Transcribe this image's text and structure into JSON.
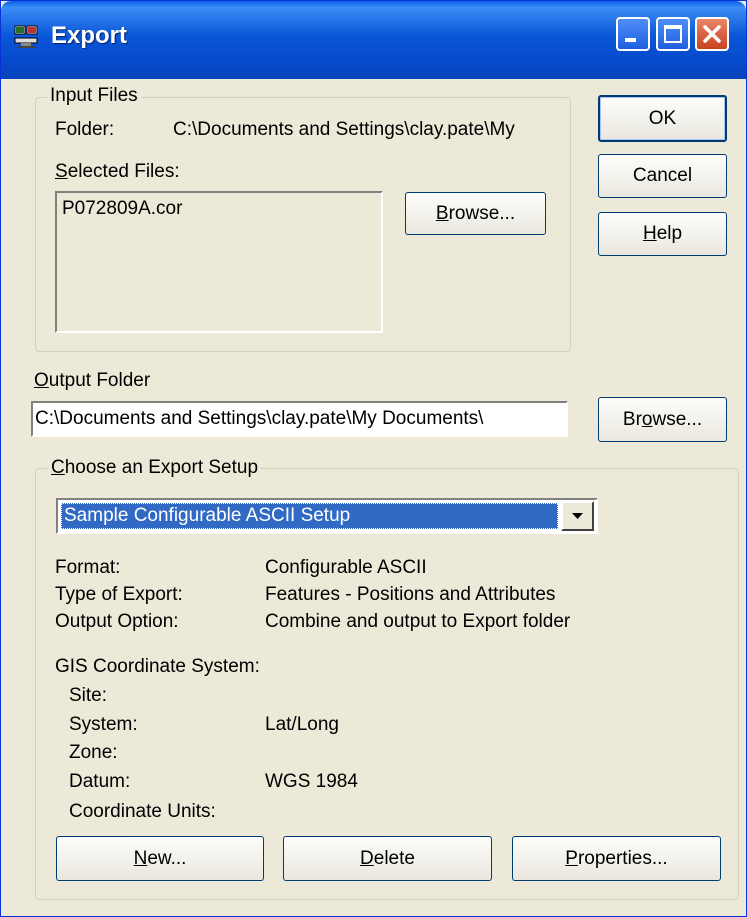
{
  "window": {
    "title": "Export"
  },
  "input_files": {
    "legend": "Input Files",
    "folder_label": "Folder:",
    "folder_value": "C:\\Documents and Settings\\clay.pate\\My",
    "selected_label_u": "S",
    "selected_label_rest": "elected Files:",
    "files": [
      "P072809A.cor"
    ],
    "browse_u": "B",
    "browse_rest": "rowse..."
  },
  "buttons": {
    "ok": "OK",
    "cancel": "Cancel",
    "help_u": "H",
    "help_rest": "elp"
  },
  "output": {
    "label_u": "O",
    "label_rest": "utput Folder",
    "value": "C:\\Documents and Settings\\clay.pate\\My Documents\\",
    "browse_pre": "Br",
    "browse_u": "o",
    "browse_rest": "wse..."
  },
  "setup": {
    "legend_u": "C",
    "legend_rest": "hoose an Export Setup",
    "selected": "Sample Configurable ASCII Setup",
    "rows": [
      {
        "label": "Format:",
        "value": "Configurable ASCII"
      },
      {
        "label": "Type of Export:",
        "value": "Features - Positions and Attributes"
      },
      {
        "label": "Output Option:",
        "value": "Combine and output to Export folder"
      }
    ],
    "gis_label": "GIS Coordinate System:",
    "gis_rows": [
      {
        "label": "Site:",
        "value": ""
      },
      {
        "label": "System:",
        "value": "Lat/Long"
      },
      {
        "label": "Zone:",
        "value": ""
      },
      {
        "label": "Datum:",
        "value": "WGS 1984"
      },
      {
        "label": "Coordinate Units:",
        "value": ""
      }
    ],
    "new_u": "N",
    "new_rest": "ew...",
    "delete_u": "D",
    "delete_rest": "elete",
    "properties_u": "P",
    "properties_rest": "roperties..."
  }
}
